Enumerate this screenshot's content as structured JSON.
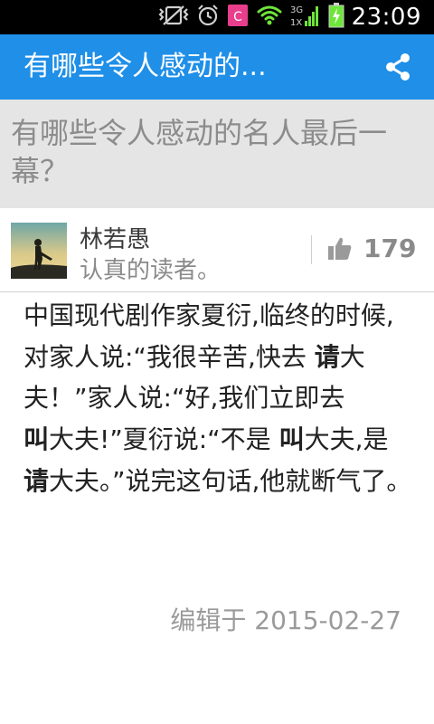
{
  "status_bar": {
    "time": "23:09",
    "icons": [
      "vibrate-mute-icon",
      "alarm-icon",
      "app-c-icon",
      "wifi-icon",
      "signal-3g-icon",
      "battery-charging-icon"
    ],
    "network_label_top": "3G",
    "network_label_bottom": "1X",
    "app_badge": "C"
  },
  "app_bar": {
    "title": "有哪些令人感动的...",
    "share_icon": "share-icon",
    "color": "#1f8fe8"
  },
  "question": {
    "title": "有哪些令人感动的名人最后一幕？"
  },
  "answer": {
    "author_name": "林若愚",
    "author_bio": "认真的读者。",
    "vote_icon": "thumbs-up-icon",
    "votes": "179",
    "content_segments": [
      {
        "text": "中国现代剧作家夏衍,临终的时候,对家人说:“我很辛苦,快去 ",
        "bold": false
      },
      {
        "text": "请",
        "bold": true
      },
      {
        "text": "大夫！”家人说:“好,我们立即去",
        "bold": false
      },
      {
        "text": "叫",
        "bold": true
      },
      {
        "text": "大夫!”夏衍说:“不是 ",
        "bold": false
      },
      {
        "text": "叫",
        "bold": true
      },
      {
        "text": "大夫,是",
        "bold": false
      },
      {
        "text": "请",
        "bold": true
      },
      {
        "text": "大夫。”说完这句话,他就断气了。",
        "bold": false
      }
    ],
    "edited_label": "编辑于 2015-02-27"
  }
}
